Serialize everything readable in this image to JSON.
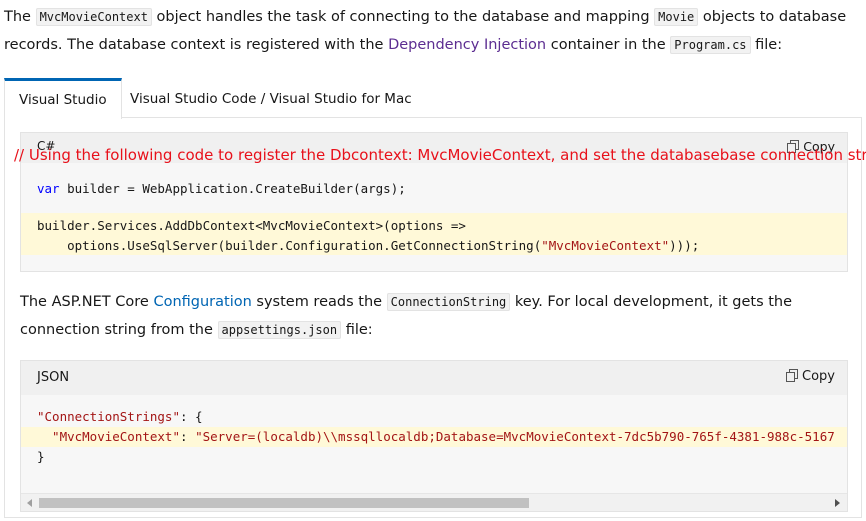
{
  "intro": {
    "t1": "The ",
    "code1": "MvcMovieContext",
    "t2": " object handles the task of connecting to the database and mapping ",
    "code2": "Movie",
    "t3": " objects to database records. The database context is registered with the ",
    "link1": "Dependency Injection",
    "t4": " container in the ",
    "code3": "Program.cs",
    "t5": " file:"
  },
  "tabs": [
    {
      "label": "Visual Studio",
      "active": true
    },
    {
      "label": "Visual Studio Code / Visual Studio for Mac",
      "active": false
    }
  ],
  "codeblock1": {
    "language": "C#",
    "copy_label": "Copy",
    "annotation": "// Using the following code to register the Dbcontext: MvcMovieContext, and set the databasebase connection string",
    "line1_kw": "var",
    "line1_rest": " builder = WebApplication.CreateBuilder(args);",
    "line2": "builder.Services.AddDbContext<MvcMovieContext>(options =>",
    "line3_a": "    options.UseSqlServer(builder.Configuration.GetConnectionString(",
    "line3_str": "\"MvcMovieContext\"",
    "line3_b": ")));"
  },
  "middle": {
    "t1": "The ASP.NET Core ",
    "link": "Configuration",
    "t2": " system reads the ",
    "code1": "ConnectionString",
    "t3": " key. For local development, it gets the connection string from the ",
    "code2": "appsettings.json",
    "t4": " file:"
  },
  "codeblock2": {
    "language": "JSON",
    "copy_label": "Copy",
    "line1_key": "\"ConnectionStrings\"",
    "line1_rest": ": {",
    "line2_key": "  \"MvcMovieContext\"",
    "line2_sep": ": ",
    "line2_val": "\"Server=(localdb)\\\\mssqllocaldb;Database=MvcMovieContext-7dc5b790-765f-4381-988c-5167",
    "line3": "}"
  }
}
